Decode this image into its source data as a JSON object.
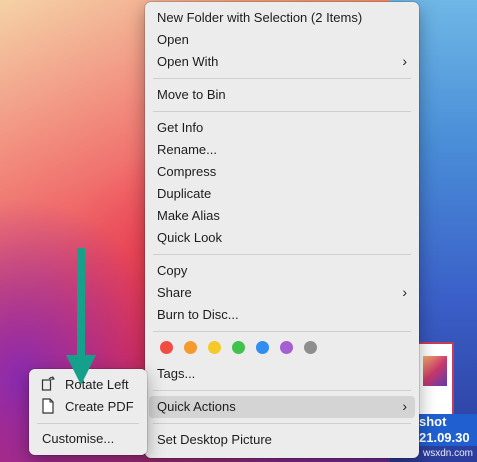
{
  "context_menu": {
    "items": [
      {
        "label": "New Folder with Selection (2 Items)"
      },
      {
        "label": "Open"
      },
      {
        "label": "Open With",
        "submenu": true
      },
      {
        "label": "Move to Bin"
      },
      {
        "label": "Get Info"
      },
      {
        "label": "Rename..."
      },
      {
        "label": "Compress"
      },
      {
        "label": "Duplicate"
      },
      {
        "label": "Make Alias"
      },
      {
        "label": "Quick Look"
      },
      {
        "label": "Copy"
      },
      {
        "label": "Share",
        "submenu": true
      },
      {
        "label": "Burn to Disc..."
      },
      {
        "label": "Tags..."
      },
      {
        "label": "Quick Actions",
        "submenu": true,
        "highlighted": true
      },
      {
        "label": "Set Desktop Picture"
      }
    ],
    "submenu_chevron": "›",
    "tag_colors": [
      "#f04e45",
      "#f59a2f",
      "#f5c92a",
      "#41c24a",
      "#2f8ef0",
      "#a55fd0",
      "#8e8e8e"
    ]
  },
  "quick_actions_submenu": {
    "items": [
      {
        "label": "Rotate Left",
        "icon": "rotate-left-icon"
      },
      {
        "label": "Create PDF",
        "icon": "document-icon"
      },
      {
        "label": "Customise..."
      }
    ]
  },
  "desktop_file": {
    "label_line1": "shot",
    "label_line2": "21.09.30"
  },
  "annotation": {
    "arrow_color": "#14a08a"
  },
  "watermark": "wsxdn.com"
}
